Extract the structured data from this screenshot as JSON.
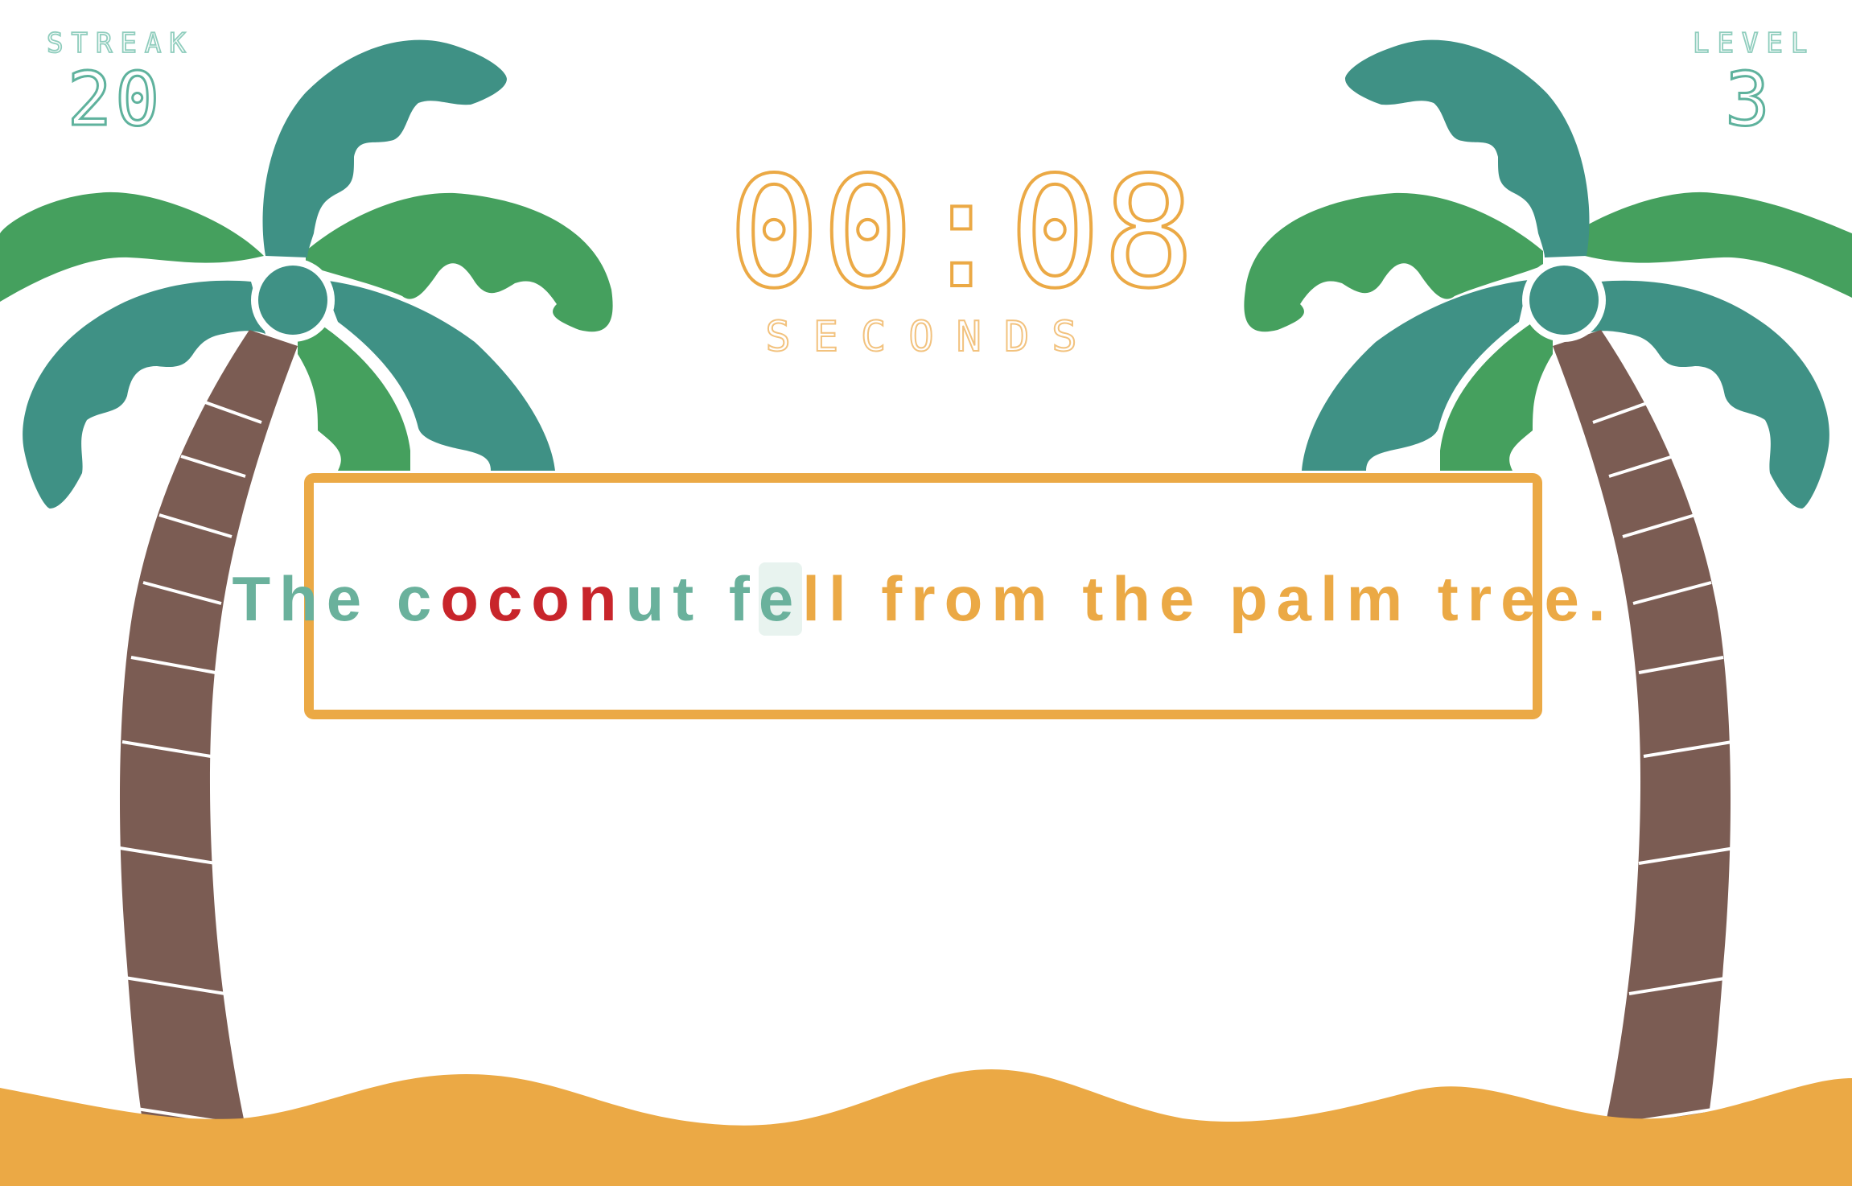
{
  "hud": {
    "streak_label": "STREAK",
    "streak_value": "20",
    "level_label": "LEVEL",
    "level_value": "3"
  },
  "timer": {
    "display": "00:08",
    "unit": "SECONDS"
  },
  "sentence": {
    "text": "The coconut fell from the palm tree.",
    "cursor_index": 13,
    "error_indices": [
      5,
      6,
      7,
      8
    ]
  },
  "colors": {
    "typed": "#6ab19c",
    "error": "#c8252b",
    "pending": "#eba945",
    "frame": "#eba945",
    "sand": "#eba945",
    "trunk": "#7b5c53",
    "leaf_teal": "#3f9185",
    "leaf_green": "#45a05e"
  },
  "icons": [
    "palm-tree-left",
    "palm-tree-right",
    "sand-dunes"
  ]
}
